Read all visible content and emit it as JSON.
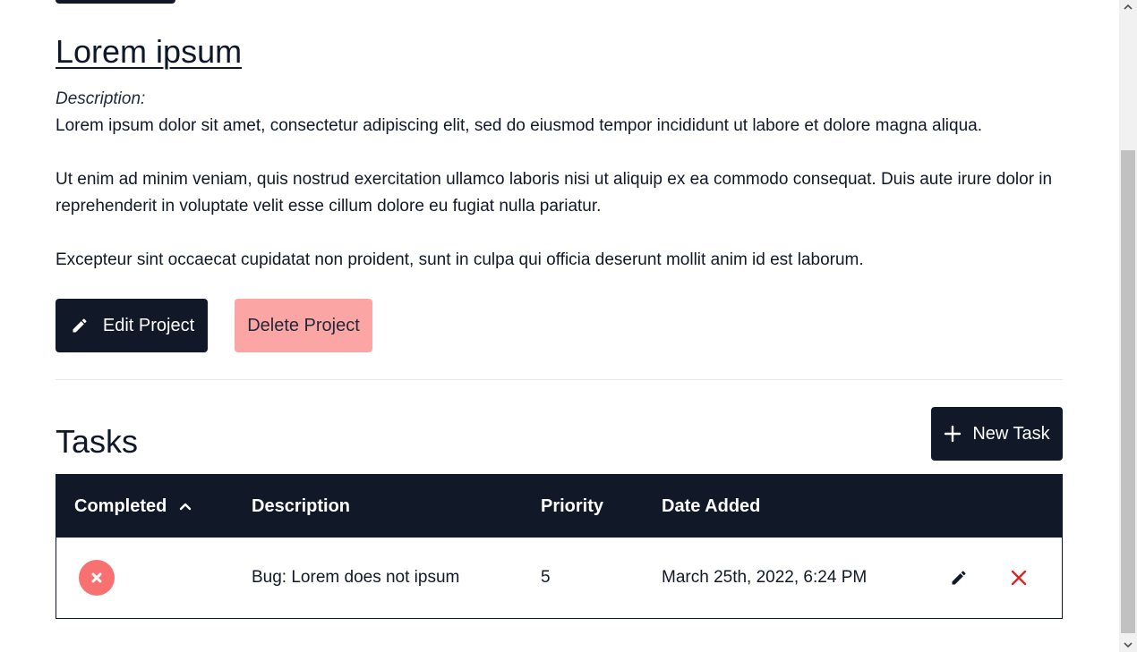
{
  "project": {
    "title": "Lorem ipsum",
    "description_label": "Description:",
    "description_paragraphs": [
      "Lorem ipsum dolor sit amet, consectetur adipiscing elit, sed do eiusmod tempor incididunt ut labore et dolore magna aliqua.",
      "Ut enim ad minim veniam, quis nostrud exercitation ullamco laboris nisi ut aliquip ex ea commodo consequat. Duis aute irure dolor in reprehenderit in voluptate velit esse cillum dolore eu fugiat nulla pariatur.",
      "Excepteur sint occaecat cupidatat non proident, sunt in culpa qui officia deserunt mollit anim id est laborum."
    ],
    "edit_label": "Edit Project",
    "delete_label": "Delete Project"
  },
  "tasks": {
    "title": "Tasks",
    "new_label": "New Task",
    "columns": {
      "completed": "Completed",
      "description": "Description",
      "priority": "Priority",
      "date_added": "Date Added"
    },
    "rows": [
      {
        "completed": false,
        "description": "Bug: Lorem does not ipsum",
        "priority": "5",
        "date_added": "March 25th, 2022, 6:24 PM"
      }
    ]
  },
  "icons": {
    "edit": "pencil-icon",
    "new": "plus-icon",
    "sort": "chevron-up-icon",
    "status": "x-circle-icon",
    "delete": "close-icon"
  },
  "colors": {
    "dark": "#111827",
    "danger_light": "#fca5a5",
    "status_incomplete": "#f87171",
    "delete_icon": "#dc2626"
  }
}
